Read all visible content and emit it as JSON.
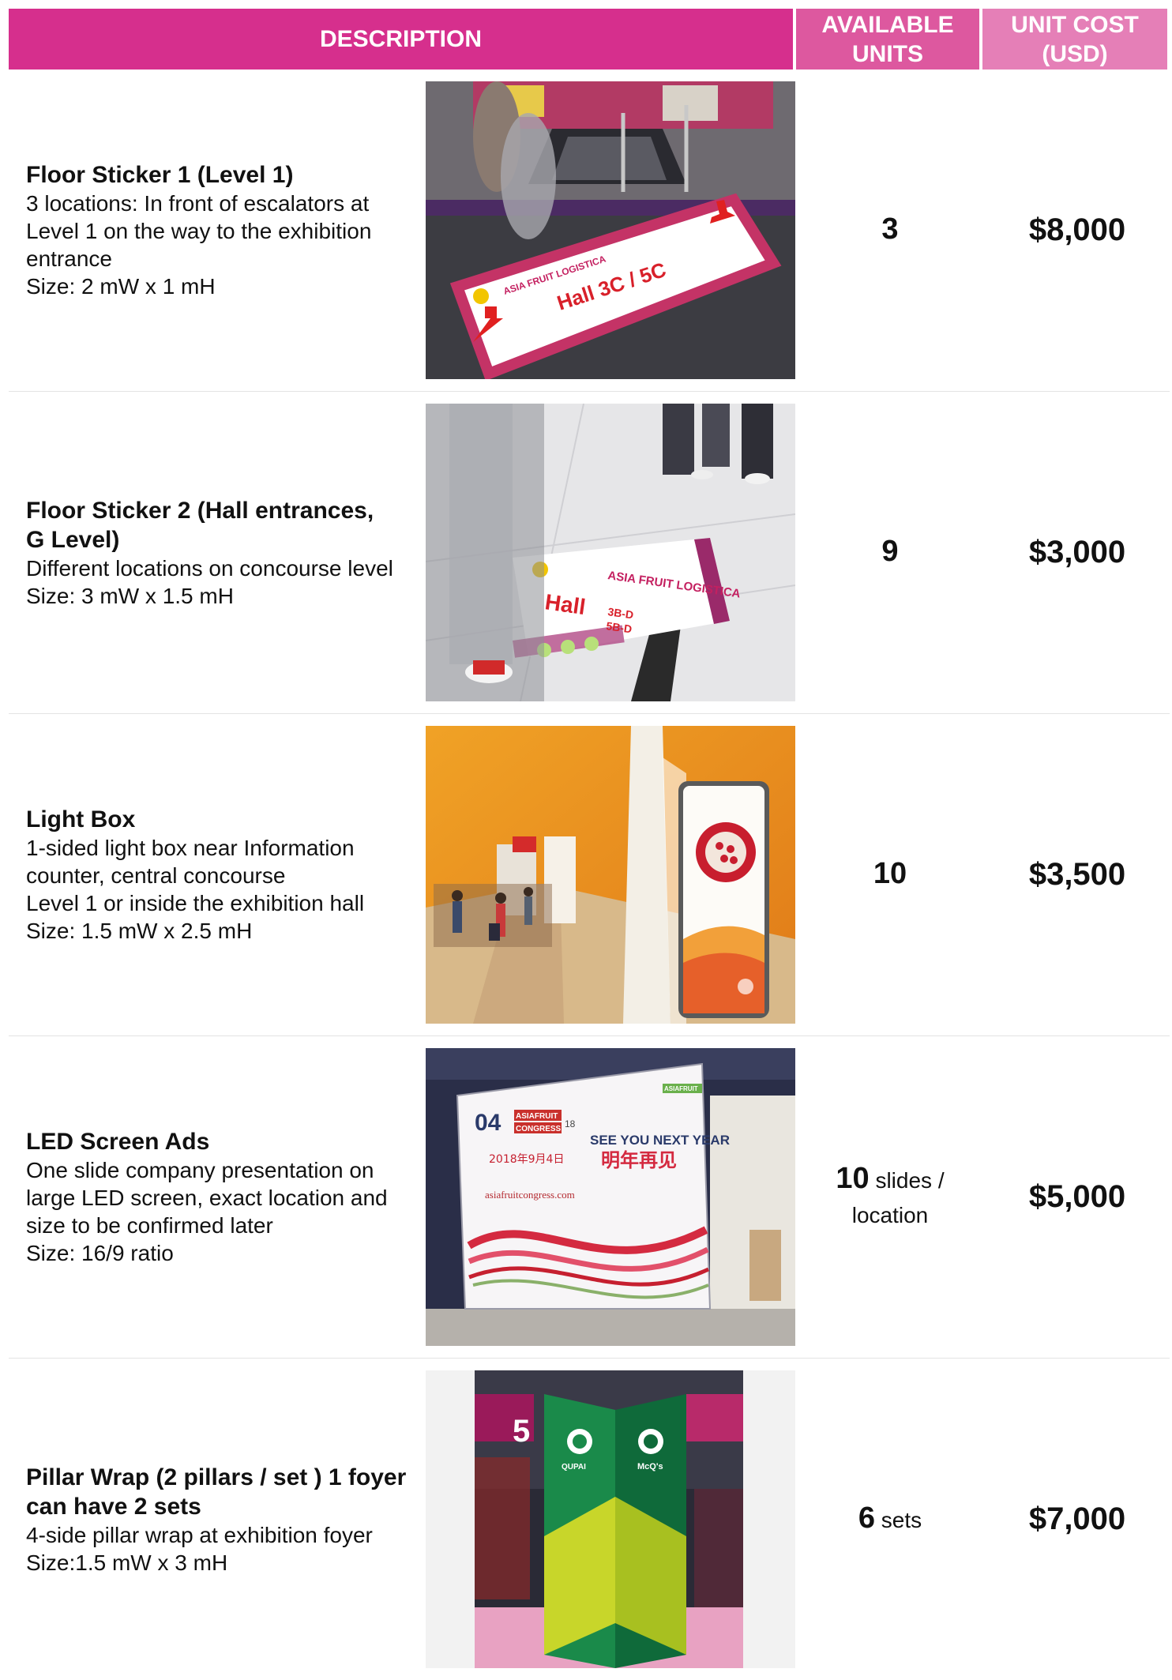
{
  "header": {
    "description": "DESCRIPTION",
    "units_line1": "AVAILABLE",
    "units_line2": "UNITS",
    "cost_line1": "UNIT COST",
    "cost_line2": "(USD)"
  },
  "rows": [
    {
      "title": "Floor Sticker 1 (Level 1)",
      "lines": [
        "3 locations: In front of escalators at",
        "Level 1 on the way to the exhibition",
        "entrance",
        "Size: 2 mW x 1 mH"
      ],
      "units_num": "3",
      "units_text": "",
      "units_line2": "",
      "cost": "$8,000",
      "photo": {
        "sign_brand": "ASIA FRUIT LOGISTICA",
        "sign_text": "Hall 3C / 5C"
      }
    },
    {
      "title": "Floor Sticker 2 (Hall entrances,",
      "title2": "G Level)",
      "lines": [
        "Different locations on concourse level",
        "Size: 3 mW x 1.5 mH"
      ],
      "units_num": "9",
      "units_text": "",
      "units_line2": "",
      "cost": "$3,000",
      "photo": {
        "sign_brand": "ASIA FRUIT LOGISTICA",
        "sign_text": "Hall",
        "sign_sub1": "3B-D",
        "sign_sub2": "5B-D"
      }
    },
    {
      "title": "Light Box",
      "lines": [
        "1-sided light box near Information",
        "counter, central concourse",
        "Level 1 or inside the exhibition hall",
        "Size: 1.5 mW x 2.5 mH"
      ],
      "units_num": "10",
      "units_text": "",
      "units_line2": "",
      "cost": "$3,500"
    },
    {
      "title": "LED Screen Ads",
      "lines": [
        "One slide company presentation on",
        "large LED screen, exact location and",
        "size to be confirmed later",
        "Size: 16/9 ratio"
      ],
      "units_num": "10",
      "units_text": " slides /",
      "units_line2": "location",
      "cost": "$5,000",
      "photo": {
        "date_num": "04",
        "brand": "ASIAFRUIT",
        "congress": "CONGRESS",
        "year": "18",
        "headline": "SEE YOU NEXT YEAR",
        "headline_cn": "明年再见",
        "date_cn": "2018年9月4日",
        "url": "asiafruitcongress.com",
        "corner_brand": "ASIAFRUIT"
      }
    },
    {
      "title": "Pillar Wrap (2 pillars / set ) 1 foyer",
      "title2": "can have 2 sets",
      "lines": [
        "4-side pillar wrap at exhibition foyer",
        "Size:1.5 mW x 3 mH"
      ],
      "units_num": "6",
      "units_text": " sets",
      "units_line2": "",
      "cost": "$7,000",
      "photo": {
        "hall_num": "5",
        "brand_left": "QUPAI",
        "brand_right": "McQ's"
      }
    }
  ],
  "colors": {
    "header_desc": "#d62f8d",
    "header_units": "#dd589f",
    "header_cost": "#e57fb7"
  }
}
